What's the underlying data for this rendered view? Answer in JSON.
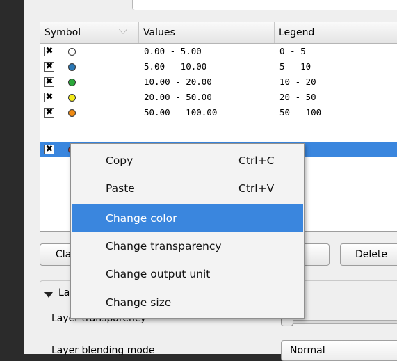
{
  "table": {
    "headers": {
      "symbol": "Symbol",
      "values": "Values",
      "legend": "Legend"
    },
    "rows": [
      {
        "checked": "✖",
        "color": "#ffffff",
        "values": "0.00 - 5.00",
        "legend": "0 - 5"
      },
      {
        "checked": "✖",
        "color": "#2b78b6",
        "values": "5.00 - 10.00",
        "legend": "5 - 10"
      },
      {
        "checked": "✖",
        "color": "#2aa83a",
        "values": "10.00 - 20.00",
        "legend": "10 - 20"
      },
      {
        "checked": "✖",
        "color": "#f2ea1b",
        "values": "20.00 - 50.00",
        "legend": "20 - 50"
      },
      {
        "checked": "✖",
        "color": "#f08a12",
        "values": "50.00 - 100.00",
        "legend": "50 - 100"
      },
      {
        "checked": "✖",
        "color": "#e33a2e",
        "values": "",
        "legend": "",
        "selected": true
      }
    ]
  },
  "buttons": {
    "classify": "Cla",
    "delete": "Delete"
  },
  "layer_section": {
    "title": "La",
    "transparency_label": "Layer transparency",
    "transparency_value": 0,
    "blending_label": "Layer blending mode",
    "blending_value": "Normal"
  },
  "context_menu": {
    "copy": {
      "label": "Copy",
      "shortcut": "Ctrl+C"
    },
    "paste": {
      "label": "Paste",
      "shortcut": "Ctrl+V"
    },
    "change_color": "Change color",
    "change_transparency": "Change transparency",
    "change_output_unit": "Change output unit",
    "change_size": "Change size"
  },
  "colors": {
    "selection": "#3a86de",
    "panel": "#efefef"
  }
}
